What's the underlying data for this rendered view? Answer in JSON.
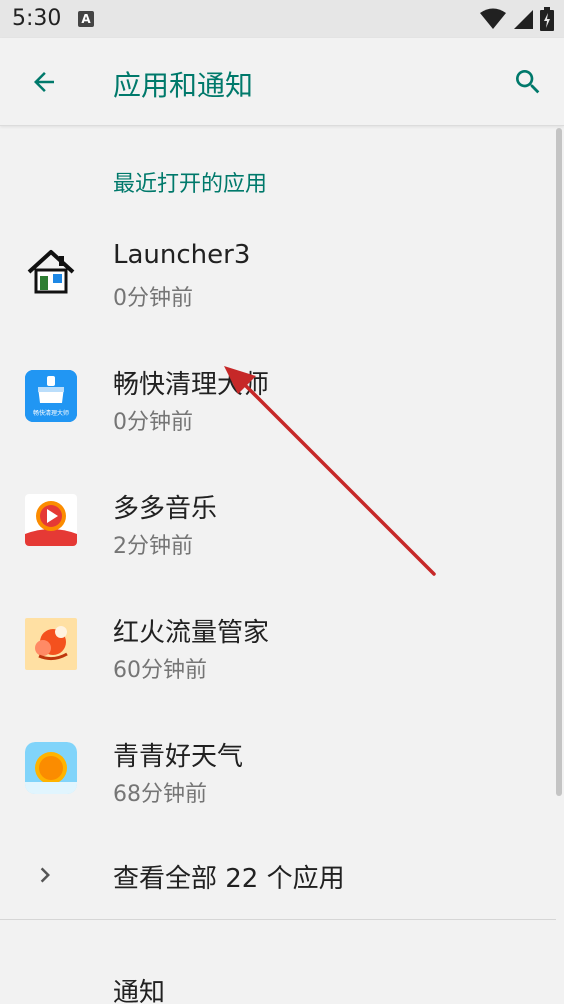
{
  "status_bar": {
    "time": "5:30",
    "notification_icon": "A"
  },
  "app_bar": {
    "title": "应用和通知",
    "back_icon": "arrow-back-icon",
    "search_icon": "search-icon"
  },
  "section": {
    "recent_header": "最近打开的应用"
  },
  "recent_apps": [
    {
      "name": "Launcher3",
      "time": "0分钟前",
      "icon": "launcher-house-icon"
    },
    {
      "name": "畅快清理大师",
      "time": "0分钟前",
      "icon": "cleaner-broom-icon",
      "icon_text": "畅快清理大师"
    },
    {
      "name": "多多音乐",
      "time": "2分钟前",
      "icon": "music-play-icon"
    },
    {
      "name": "红火流量管家",
      "time": "60分钟前",
      "icon": "traffic-manager-icon"
    },
    {
      "name": "青青好天气",
      "time": "68分钟前",
      "icon": "weather-sun-icon"
    }
  ],
  "see_all": {
    "label": "查看全部 22 个应用"
  },
  "notifications": {
    "label": "通知"
  },
  "colors": {
    "accent": "#00796b",
    "background": "#f2f2f2",
    "secondary_text": "#757575",
    "annotation_arrow": "#c62828"
  }
}
